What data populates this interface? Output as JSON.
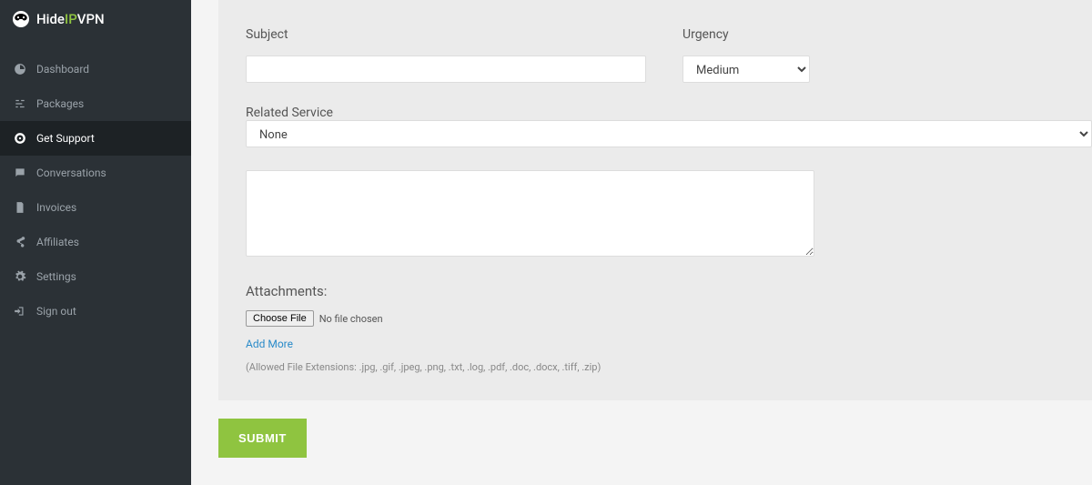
{
  "brand": {
    "part1": "Hide",
    "part2": "IP",
    "part3": "VPN"
  },
  "sidebar": {
    "items": [
      {
        "label": "Dashboard"
      },
      {
        "label": "Packages"
      },
      {
        "label": "Get Support"
      },
      {
        "label": "Conversations"
      },
      {
        "label": "Invoices"
      },
      {
        "label": "Affiliates"
      },
      {
        "label": "Settings"
      },
      {
        "label": "Sign out"
      }
    ]
  },
  "form": {
    "subject_label": "Subject",
    "subject_value": "",
    "urgency_label": "Urgency",
    "urgency_value": "Medium",
    "related_label": "Related Service",
    "related_value": "None",
    "message_value": "",
    "attachments_label": "Attachments:",
    "choose_file_label": "Choose File",
    "no_file_text": "No file chosen",
    "add_more_label": "Add More",
    "extensions_hint": "(Allowed File Extensions: .jpg, .gif, .jpeg, .png, .txt, .log, .pdf, .doc, .docx, .tiff, .zip)",
    "submit_label": "SUBMIT"
  }
}
